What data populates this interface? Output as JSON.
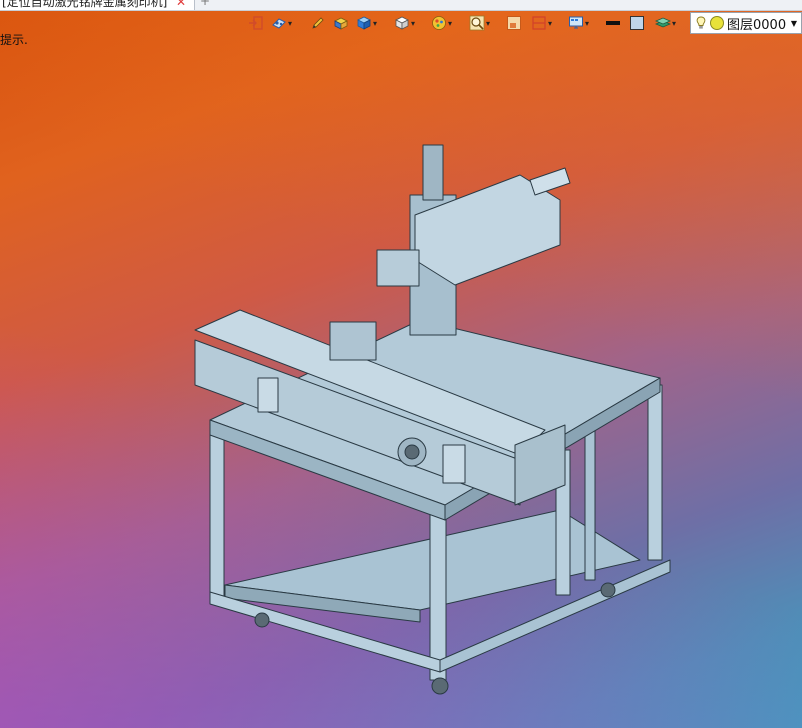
{
  "tab": {
    "title": "[定位自动激光铭牌金属刻印机]",
    "close_glyph": "✕",
    "new_tab_glyph": "+"
  },
  "toolbar": {
    "tools": [
      {
        "id": "exit",
        "icon": "exit-icon"
      },
      {
        "id": "view-mode",
        "icon": "view-mode-icon",
        "dropdown": true
      },
      {
        "id": "sketch",
        "icon": "pencil-icon"
      },
      {
        "id": "iso-view",
        "icon": "iso-box-yellow-icon"
      },
      {
        "id": "view-cube",
        "icon": "view-cube-icon",
        "dropdown": true
      },
      {
        "id": "standard-views",
        "icon": "white-cube-icon",
        "dropdown": true
      },
      {
        "id": "render-style",
        "icon": "render-style-icon",
        "dropdown": true
      },
      {
        "id": "zoom",
        "icon": "zoom-icon",
        "dropdown": true
      },
      {
        "id": "section",
        "icon": "section-icon"
      },
      {
        "id": "clip",
        "icon": "clip-plane-icon",
        "dropdown": true
      },
      {
        "id": "display",
        "icon": "monitor-icon",
        "dropdown": true
      },
      {
        "id": "line-color",
        "icon": "line-color-icon"
      },
      {
        "id": "fill-color",
        "icon": "fill-color-icon"
      },
      {
        "id": "layers",
        "icon": "layers-icon",
        "dropdown": true
      }
    ],
    "colors": {
      "accent": "#2f7bd8",
      "line": "#111111",
      "fill": "#bfd6ea"
    }
  },
  "layer": {
    "name": "图层0000",
    "icons": [
      "bulb-icon",
      "sun-icon"
    ]
  },
  "hint": "提示."
}
